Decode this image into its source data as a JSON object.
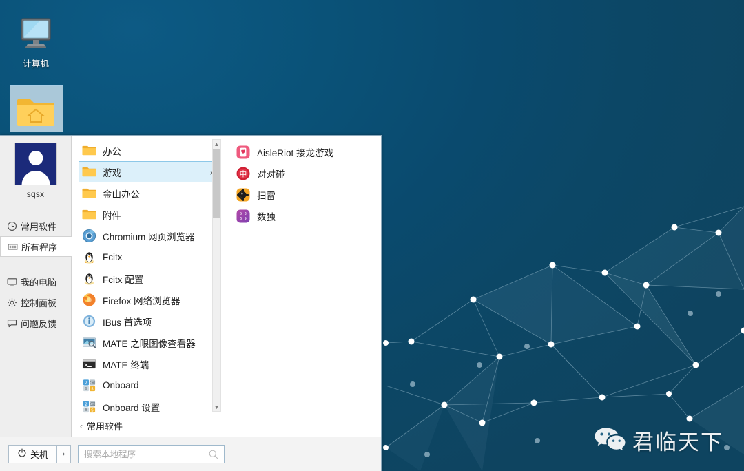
{
  "desktop": {
    "icons": [
      {
        "name": "computer",
        "label": "计算机",
        "icon": "monitor-icon",
        "selected": false
      },
      {
        "name": "home-folder",
        "label": "",
        "icon": "home-folder-icon",
        "selected": true
      }
    ],
    "watermark": {
      "text": "君临天下",
      "icon": "wechat-icon"
    },
    "wallpaper": {
      "base_color": "#0a4e73",
      "accent_color": "#0d5a84",
      "node_color": "#ffffff"
    }
  },
  "start_menu": {
    "user": {
      "name": "sqsx",
      "avatar_icon": "user-avatar-icon",
      "avatar_bg": "#1b2a7a"
    },
    "rail": {
      "items": [
        {
          "key": "frequent",
          "label": "常用软件",
          "icon": "clock-icon",
          "selected": false
        },
        {
          "key": "all-programs",
          "label": "所有程序",
          "icon": "grid-icon",
          "selected": true
        },
        {
          "key": "my-computer",
          "label": "我的电脑",
          "icon": "monitor-icon",
          "selected": false
        },
        {
          "key": "control-panel",
          "label": "控制面板",
          "icon": "gear-icon",
          "selected": false
        },
        {
          "key": "feedback",
          "label": "问题反馈",
          "icon": "speech-bubble-icon",
          "selected": false
        }
      ]
    },
    "app_list": {
      "items": [
        {
          "label": "办公",
          "icon": "folder-icon",
          "type": "folder",
          "active": false,
          "has_submenu": false
        },
        {
          "label": "游戏",
          "icon": "folder-icon",
          "type": "folder",
          "active": true,
          "has_submenu": true
        },
        {
          "label": "金山办公",
          "icon": "folder-icon",
          "type": "folder",
          "active": false,
          "has_submenu": false
        },
        {
          "label": "附件",
          "icon": "folder-icon",
          "type": "folder",
          "active": false,
          "has_submenu": false
        },
        {
          "label": "Chromium 网页浏览器",
          "icon": "chromium-icon",
          "type": "app",
          "active": false,
          "has_submenu": false
        },
        {
          "label": "Fcitx",
          "icon": "fcitx-penguin-icon",
          "type": "app",
          "active": false,
          "has_submenu": false
        },
        {
          "label": "Fcitx 配置",
          "icon": "fcitx-penguin-icon",
          "type": "app",
          "active": false,
          "has_submenu": false
        },
        {
          "label": "Firefox 网络浏览器",
          "icon": "firefox-icon",
          "type": "app",
          "active": false,
          "has_submenu": false
        },
        {
          "label": "IBus 首选项",
          "icon": "ibus-info-icon",
          "type": "app",
          "active": false,
          "has_submenu": false
        },
        {
          "label": "MATE 之眼图像查看器",
          "icon": "eye-of-mate-icon",
          "type": "app",
          "active": false,
          "has_submenu": false
        },
        {
          "label": "MATE 终端",
          "icon": "terminal-icon",
          "type": "app",
          "active": false,
          "has_submenu": false
        },
        {
          "label": "Onboard",
          "icon": "onboard-keyboard-icon",
          "type": "app",
          "active": false,
          "has_submenu": false
        },
        {
          "label": "Onboard 设置",
          "icon": "onboard-keyboard-icon",
          "type": "app",
          "active": false,
          "has_submenu": false
        }
      ],
      "scrollbar": {
        "up_arrow": "▲",
        "down_arrow": "▼"
      }
    },
    "back_row": {
      "label": "常用软件",
      "caret": "‹"
    },
    "submenu": {
      "parent": "游戏",
      "items": [
        {
          "label": "AisleRiot 接龙游戏",
          "icon": "aisleriot-card-icon",
          "color": "#e8486f"
        },
        {
          "label": "对对碰",
          "icon": "mahjongg-icon",
          "color": "#cc1f33"
        },
        {
          "label": "扫雷",
          "icon": "mines-icon",
          "color": "#f5a623"
        },
        {
          "label": "数独",
          "icon": "sudoku-icon",
          "color": "#a63ca0"
        }
      ]
    },
    "footer": {
      "power_label": "关机",
      "power_icon": "power-icon",
      "more_arrow": "›",
      "search_placeholder": "搜索本地程序",
      "search_value": "",
      "search_icon": "search-icon"
    }
  }
}
